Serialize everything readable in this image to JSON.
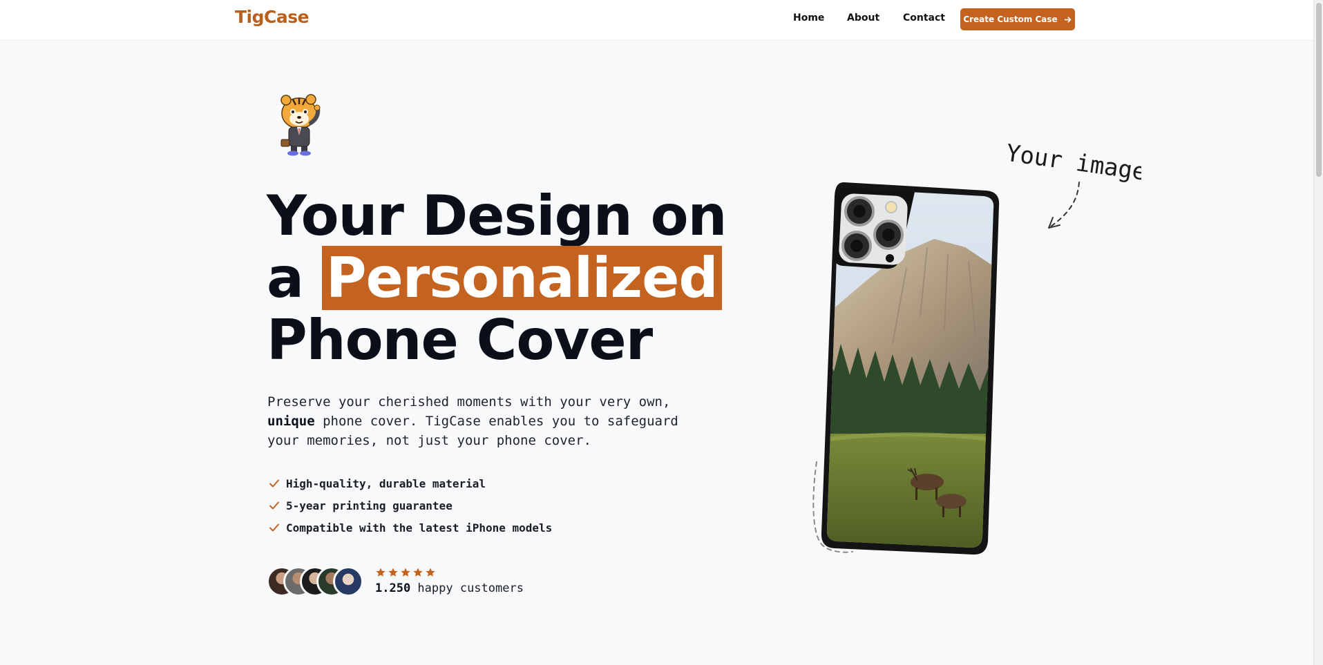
{
  "nav": {
    "logo": "TigCase",
    "links": [
      "Home",
      "About",
      "Contact"
    ],
    "cta_label": "Create Custom Case",
    "cta_icon": "arrow-right-icon"
  },
  "hero": {
    "title_part1": "Your Design on",
    "title_part2": "a ",
    "title_highlight": "Personalized",
    "title_part3": "Phone Cover",
    "description_before": "Preserve your cherished moments with your very own, ",
    "description_bold": "unique",
    "description_after": " phone cover. TigCase enables you to safeguard your memories, not just your phone cover.",
    "features": [
      "High-quality, durable material",
      "5-year printing guarantee",
      "Compatible with the latest iPhone models"
    ],
    "customers_count": "1.250",
    "customers_label": " happy customers",
    "star_rating": 5,
    "annotation": "Your image"
  },
  "colors": {
    "brand": "#c4621f",
    "text": "#0b0f1a",
    "background": "#f8f9fa"
  }
}
